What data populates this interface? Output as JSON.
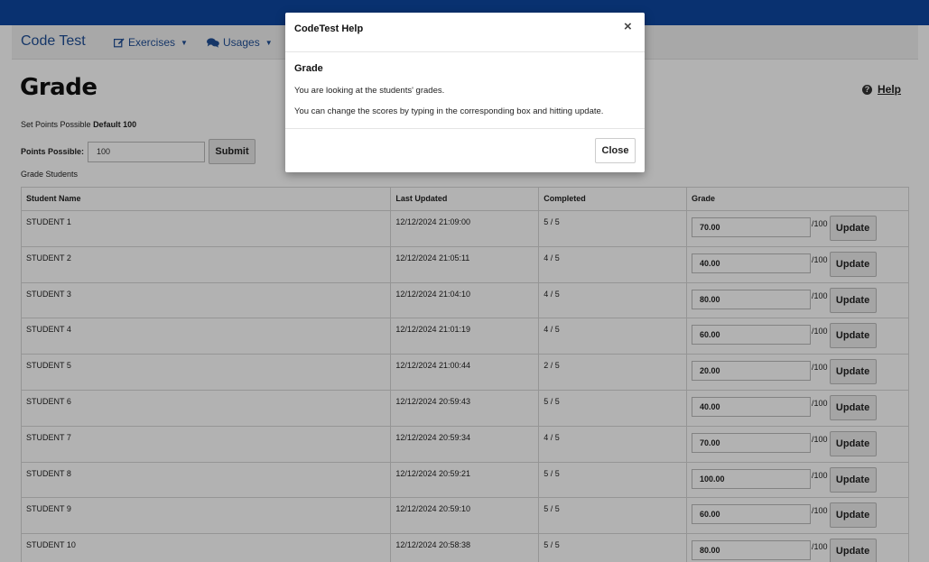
{
  "navbar": {
    "brand": "Code Test",
    "exercises_label": "Exercises",
    "usages_label": "Usages"
  },
  "page": {
    "title": "Grade",
    "help_label": "Help",
    "set_points_label": "Set Points Possible",
    "set_points_default": "Default 100",
    "points_possible_label": "Points Possible:",
    "points_possible_value": "100",
    "submit_label": "Submit",
    "grade_students_label": "Grade Students"
  },
  "table": {
    "headers": {
      "student": "Student Name",
      "updated": "Last Updated",
      "completed": "Completed",
      "grade": "Grade"
    },
    "out_of": "/100",
    "update_label": "Update",
    "rows": [
      {
        "name": "STUDENT 1",
        "updated": "12/12/2024 21:09:00",
        "completed": "5 / 5",
        "grade": "70.00"
      },
      {
        "name": "STUDENT 2",
        "updated": "12/12/2024 21:05:11",
        "completed": "4 / 5",
        "grade": "40.00"
      },
      {
        "name": "STUDENT 3",
        "updated": "12/12/2024 21:04:10",
        "completed": "4 / 5",
        "grade": "80.00"
      },
      {
        "name": "STUDENT 4",
        "updated": "12/12/2024 21:01:19",
        "completed": "4 / 5",
        "grade": "60.00"
      },
      {
        "name": "STUDENT 5",
        "updated": "12/12/2024 21:00:44",
        "completed": "2 / 5",
        "grade": "20.00"
      },
      {
        "name": "STUDENT 6",
        "updated": "12/12/2024 20:59:43",
        "completed": "5 / 5",
        "grade": "40.00"
      },
      {
        "name": "STUDENT 7",
        "updated": "12/12/2024 20:59:34",
        "completed": "4 / 5",
        "grade": "70.00"
      },
      {
        "name": "STUDENT 8",
        "updated": "12/12/2024 20:59:21",
        "completed": "5 / 5",
        "grade": "100.00"
      },
      {
        "name": "STUDENT 9",
        "updated": "12/12/2024 20:59:10",
        "completed": "5 / 5",
        "grade": "60.00"
      },
      {
        "name": "STUDENT 10",
        "updated": "12/12/2024 20:58:38",
        "completed": "5 / 5",
        "grade": "80.00"
      }
    ]
  },
  "modal": {
    "title": "CodeTest Help",
    "close_x": "×",
    "heading": "Grade",
    "line1": "You are looking at the students' grades.",
    "line2": "You can change the scores by typing in the corresponding box and hitting update.",
    "close_label": "Close"
  },
  "colors": {
    "topbar": "#0d47a1",
    "brand": "#1f4e96"
  },
  "icons": {
    "exercises": "edit-icon",
    "usages": "comments-icon",
    "help": "question-circle-icon",
    "modal_close": "close-icon"
  }
}
